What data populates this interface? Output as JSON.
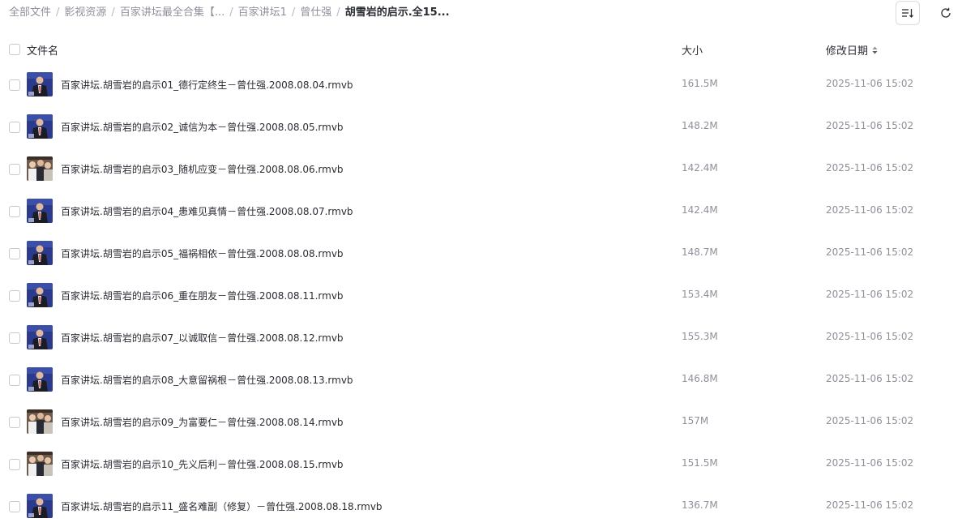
{
  "breadcrumb": {
    "items": [
      "全部文件",
      "影视资源",
      "百家讲坛最全合集【...",
      "百家讲坛1",
      "曾仕强"
    ],
    "current": "胡雪岩的启示.全15...",
    "separator": "/"
  },
  "toolbar": {
    "sort_icon": "sort-list-icon",
    "refresh_icon": "refresh-icon"
  },
  "table": {
    "headers": {
      "name": "文件名",
      "size": "大小",
      "date": "修改日期"
    },
    "rows": [
      {
        "name": "百家讲坛.胡雪岩的启示01_德行定终生－曾仕强.2008.08.04.rmvb",
        "size": "161.5M",
        "date": "2025-11-06 15:02"
      },
      {
        "name": "百家讲坛.胡雪岩的启示02_诚信为本－曾仕强.2008.08.05.rmvb",
        "size": "148.2M",
        "date": "2025-11-06 15:02"
      },
      {
        "name": "百家讲坛.胡雪岩的启示03_随机应变－曾仕强.2008.08.06.rmvb",
        "size": "142.4M",
        "date": "2025-11-06 15:02"
      },
      {
        "name": "百家讲坛.胡雪岩的启示04_患难见真情－曾仕强.2008.08.07.rmvb",
        "size": "142.4M",
        "date": "2025-11-06 15:02"
      },
      {
        "name": "百家讲坛.胡雪岩的启示05_福祸相依－曾仕强.2008.08.08.rmvb",
        "size": "148.7M",
        "date": "2025-11-06 15:02"
      },
      {
        "name": "百家讲坛.胡雪岩的启示06_重在朋友－曾仕强.2008.08.11.rmvb",
        "size": "153.4M",
        "date": "2025-11-06 15:02"
      },
      {
        "name": "百家讲坛.胡雪岩的启示07_以诚取信－曾仕强.2008.08.12.rmvb",
        "size": "155.3M",
        "date": "2025-11-06 15:02"
      },
      {
        "name": "百家讲坛.胡雪岩的启示08_大意留祸根－曾仕强.2008.08.13.rmvb",
        "size": "146.8M",
        "date": "2025-11-06 15:02"
      },
      {
        "name": "百家讲坛.胡雪岩的启示09_为富要仁－曾仕强.2008.08.14.rmvb",
        "size": "157M",
        "date": "2025-11-06 15:02"
      },
      {
        "name": "百家讲坛.胡雪岩的启示10_先义后利－曾仕强.2008.08.15.rmvb",
        "size": "151.5M",
        "date": "2025-11-06 15:02"
      },
      {
        "name": "百家讲坛.胡雪岩的启示11_盛名难副（修复）－曾仕强.2008.08.18.rmvb",
        "size": "136.7M",
        "date": "2025-11-06 15:02"
      }
    ]
  },
  "colors": {
    "text_primary": "#2a2c33",
    "text_secondary": "#8e909a",
    "thumb_blue": "#2b3a8c",
    "thumb_suit": "#1c1d24",
    "thumb_tie": "#b8232a",
    "thumb_crowd": "#6e5a4a"
  }
}
